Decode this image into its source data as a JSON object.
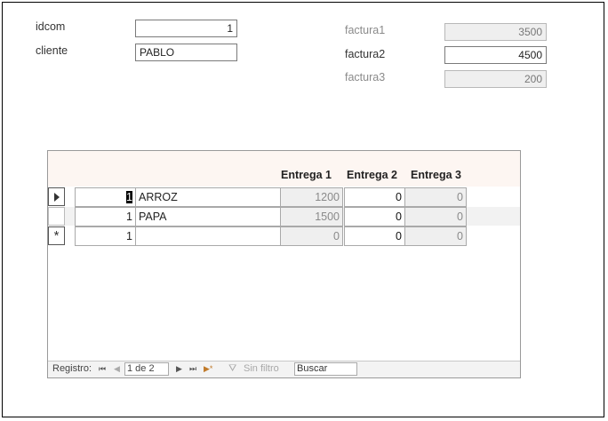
{
  "header": {
    "idcom_label": "idcom",
    "idcom_value": "1",
    "cliente_label": "cliente",
    "cliente_value": "PABLO",
    "factura1_label": "factura1",
    "factura1_value": "3500",
    "factura2_label": "factura2",
    "factura2_value": "4500",
    "factura3_label": "factura3",
    "factura3_value": "200"
  },
  "subform": {
    "columns": [
      "Entrega 1",
      "Entrega 2",
      "Entrega 3"
    ],
    "rows": [
      {
        "id": "1",
        "producto": "ARROZ",
        "e1": "1200",
        "e2": "0",
        "e3": "0"
      },
      {
        "id": "1",
        "producto": "PAPA",
        "e1": "1500",
        "e2": "0",
        "e3": "0"
      },
      {
        "id": "1",
        "producto": "",
        "e1": "0",
        "e2": "0",
        "e3": "0"
      }
    ],
    "new_row_marker": "*"
  },
  "navigator": {
    "registro_label": "Registro:",
    "first": "⏮",
    "prev": "◀",
    "position": "1 de 2",
    "next": "▶",
    "last": "⏭",
    "new": "▶*",
    "filter_label": "Sin filtro",
    "search_value": "Buscar"
  },
  "colors": {
    "header_band": "#fdf6f2",
    "locked_cell": "#efefef",
    "alt_row": "#f2f2f2"
  }
}
